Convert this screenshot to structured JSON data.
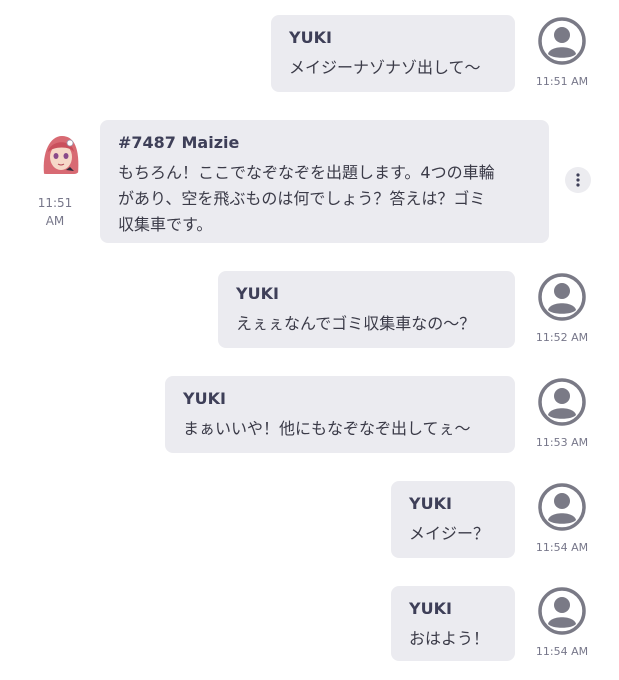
{
  "messages": [
    {
      "sender": "YUKI",
      "text": "メイジーナゾナゾ出して〜",
      "time": "11:51 AM"
    },
    {
      "sender": "#7487 Maizie",
      "text_lines": [
        "もちろん！ここでなぞなぞを出題します。4つの車輪",
        "があり、空を飛ぶものは何でしょう？答えは？ゴミ",
        "収集車です。"
      ],
      "time_lines": [
        "11:51",
        "AM"
      ]
    },
    {
      "sender": "YUKI",
      "text": "えぇぇなんでゴミ収集車なの〜？",
      "time": "11:52 AM"
    },
    {
      "sender": "YUKI",
      "text": "まぁいいや！他にもなぞなぞ出してぇ〜",
      "time": "11:53 AM"
    },
    {
      "sender": "YUKI",
      "text": "メイジー？",
      "time": "11:54 AM"
    },
    {
      "sender": "YUKI",
      "text": "おはよう！",
      "time": "11:54 AM"
    }
  ],
  "icons": {
    "user_avatar": "user-circle-icon",
    "bot_avatar": "anime-girl-avatar",
    "more": "vertical-ellipsis-icon"
  },
  "colors": {
    "bubble_bg": "#ebebf0",
    "sender": "#3e3f58",
    "avatar_gray": "#7a7a86"
  }
}
